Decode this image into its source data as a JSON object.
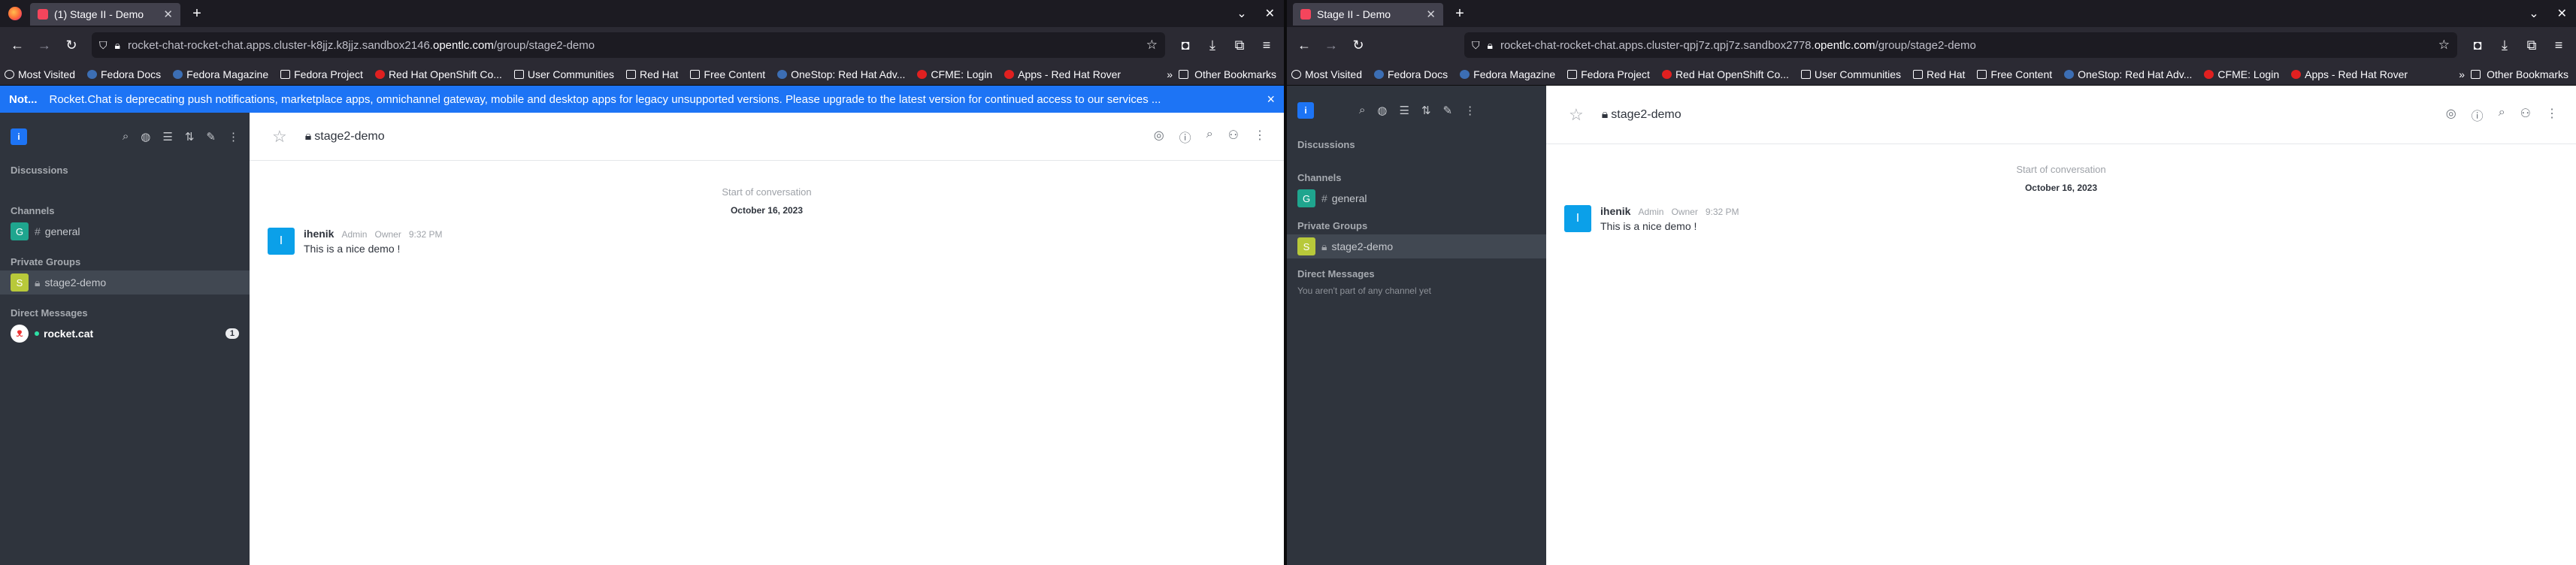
{
  "left": {
    "tab_title": "(1) Stage II - Demo",
    "url_prefix": "rocket-chat-rocket-chat.apps.cluster-k8jjz.k8jjz.sandbox2146.",
    "url_domain": "opentlc.com",
    "url_path": "/group/stage2-demo",
    "banner": {
      "title": "Not...",
      "text": "Rocket.Chat is deprecating push notifications, marketplace apps, omnichannel gateway, mobile and desktop apps for legacy unsupported versions. Please upgrade to the latest version for continued access to our services ...",
      "close": "×"
    },
    "sidebar": {
      "discussions": "Discussions",
      "channels_header": "Channels",
      "channel": {
        "avatar": "G",
        "name": "general"
      },
      "private_header": "Private Groups",
      "group": {
        "avatar": "S",
        "name": "stage2-demo"
      },
      "dm_header": "Direct Messages",
      "dm": {
        "name": "rocket.cat",
        "badge": "1"
      }
    }
  },
  "right": {
    "tab_title": "Stage II - Demo",
    "url_prefix": "rocket-chat-rocket-chat.apps.cluster-qpj7z.qpj7z.sandbox2778.",
    "url_domain": "opentlc.com",
    "url_path": "/group/stage2-demo",
    "sidebar": {
      "discussions": "Discussions",
      "channels_header": "Channels",
      "channel": {
        "avatar": "G",
        "name": "general"
      },
      "private_header": "Private Groups",
      "group": {
        "avatar": "S",
        "name": "stage2-demo"
      },
      "dm_header": "Direct Messages",
      "dm_empty": "You aren't part of any channel yet"
    }
  },
  "bookmarks": [
    "Most Visited",
    "Fedora Docs",
    "Fedora Magazine",
    "Fedora Project",
    "Red Hat OpenShift Co...",
    "User Communities",
    "Red Hat",
    "Free Content",
    "OneStop: Red Hat Adv...",
    "CFME: Login",
    "Apps - Red Hat Rover"
  ],
  "other_bookmarks": "Other Bookmarks",
  "room": {
    "name": "stage2-demo",
    "start": "Start of conversation",
    "date": "October 16, 2023",
    "message": {
      "avatar": "I",
      "user": "ihenik",
      "role1": "Admin",
      "role2": "Owner",
      "time": "9:32 PM",
      "text": "This is a nice demo !"
    }
  },
  "me_avatar": "i",
  "colors": {
    "accent": "#1d74f5",
    "sidebar": "#2f343d"
  },
  "icons": [
    "firefox-icon",
    "back-icon",
    "forward-icon",
    "reload-icon",
    "lock-icon",
    "star-icon",
    "search-icon",
    "directory-icon",
    "sort-icon",
    "edit-icon",
    "kebab-icon",
    "thread-icon",
    "info-icon",
    "members-icon"
  ]
}
